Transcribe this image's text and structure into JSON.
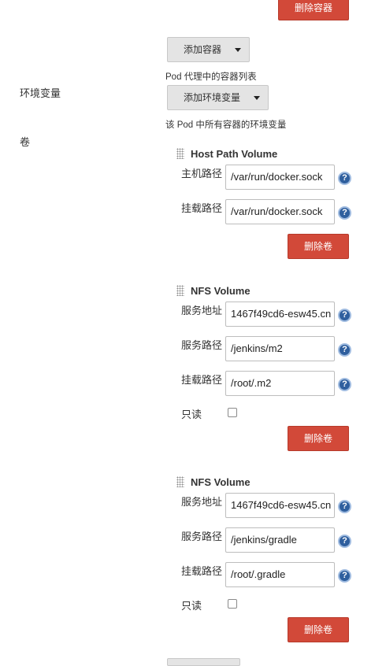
{
  "top": {
    "delete_container_label": "删除容器",
    "add_container_label": "添加容器",
    "pod_container_desc": "Pod 代理中的容器列表"
  },
  "env": {
    "label": "环境变量",
    "add_env_label": "添加环境变量",
    "desc": "该 Pod 中所有容器的环境变量"
  },
  "volumes": {
    "label": "卷",
    "host_path": {
      "title": "Host Path Volume",
      "host_path_label": "主机路径",
      "host_path_value": "/var/run/docker.sock",
      "mount_path_label": "挂载路径",
      "mount_path_value": "/var/run/docker.sock",
      "delete_label": "删除卷"
    },
    "nfs1": {
      "title": "NFS Volume",
      "server_label": "服务地址",
      "server_value": "1467f49cd6-esw45.cn",
      "server_path_label": "服务路径",
      "server_path_value": "/jenkins/m2",
      "mount_path_label": "挂载路径",
      "mount_path_value": "/root/.m2",
      "readonly_label": "只读",
      "readonly": false,
      "delete_label": "删除卷"
    },
    "nfs2": {
      "title": "NFS Volume",
      "server_label": "服务地址",
      "server_value": "1467f49cd6-esw45.cn",
      "server_path_label": "服务路径",
      "server_path_value": "/jenkins/gradle",
      "mount_path_label": "挂载路径",
      "mount_path_value": "/root/.gradle",
      "readonly_label": "只读",
      "readonly": false,
      "delete_label": "删除卷"
    }
  },
  "help_glyph": "?",
  "colors": {
    "danger": "#d24939",
    "help": "#2f5f9e",
    "button_gray": "#e4e4e4"
  }
}
